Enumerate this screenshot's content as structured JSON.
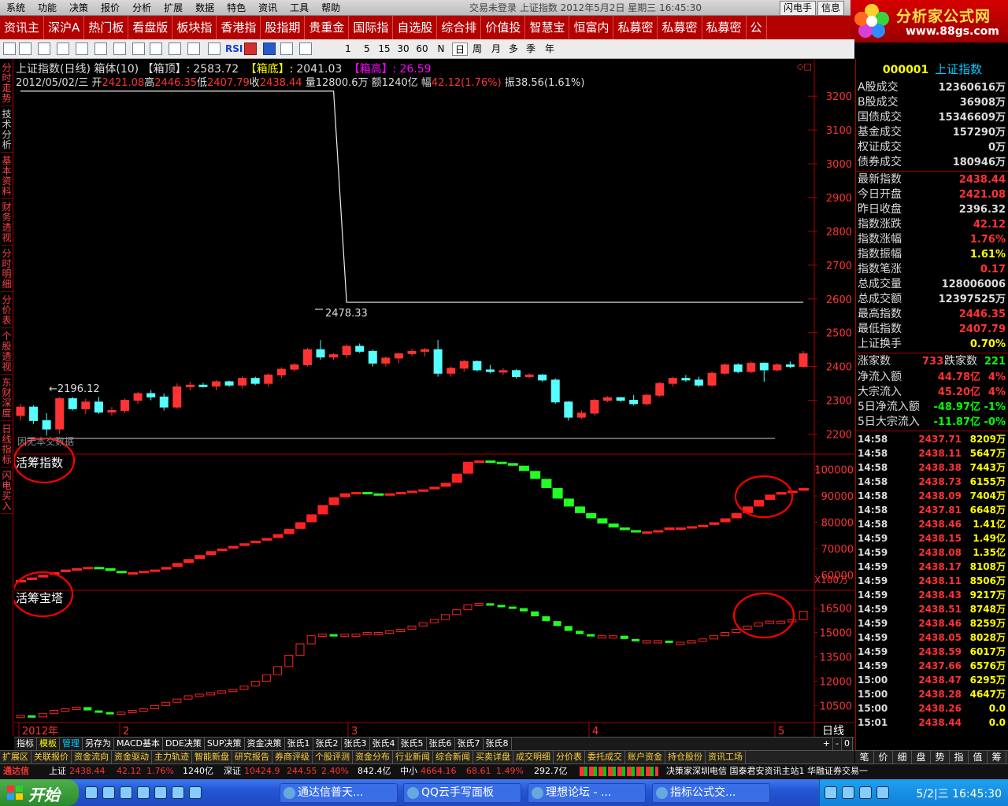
{
  "titlebar": {
    "menus": [
      "系统",
      "功能",
      "决策",
      "报价",
      "分析",
      "扩展",
      "数据",
      "特色",
      "资讯",
      "工具",
      "帮助"
    ],
    "status": "交易未登录  上证指数  2012年5月2日 星期三  16:45:30",
    "buttons": [
      "闪电手",
      "信息"
    ]
  },
  "logo": {
    "name": "分析家公式网",
    "url": "www.88gs.com"
  },
  "nav": [
    "资讯主",
    "深沪A",
    "热门板",
    "看盘版",
    "板块指",
    "香港指",
    "股指期",
    "贵重金",
    "国际指",
    "自选股",
    "综合排",
    "价值投",
    "智慧宝",
    "恒富内",
    "私募密",
    "私募密",
    "私募密",
    "公"
  ],
  "toolbar": {
    "periods": [
      "1",
      "5",
      "15",
      "30",
      "60",
      "N",
      "日",
      "周",
      "月",
      "多",
      "季",
      "年"
    ],
    "rsi": "RSI"
  },
  "left_tabs": [
    "分时走势",
    "技术分析",
    "基本资料",
    "财务透视",
    "分时明细",
    "分价表",
    "个股透视",
    "东财深度",
    "日线指标",
    "闪电买入"
  ],
  "chart": {
    "header1": {
      "name": "上证指数(日线) 箱体(10)",
      "box_top_label": "【箱顶】",
      "box_top_sep": ":",
      "box_top": "2583.72",
      "box_bottom_label": "【箱底】",
      "box_bottom_sep": ":",
      "box_bottom": "2041.03",
      "box_height_label": "【箱高】",
      "box_height_sep": ":",
      "box_height": "26.59"
    },
    "header2": {
      "date": "2012/05/02/三",
      "open_label": "开",
      "open": "2421.08",
      "high_label": "高",
      "high": "2446.35",
      "low_label": "低",
      "low": "2407.79",
      "close_label": "收",
      "close": "2438.44",
      "vol_label": "量",
      "vol": "12800.6万",
      "amt_label": "额",
      "amt": "1240亿",
      "chg_label": "幅",
      "chg": "42.12(1.76%)",
      "amp_label": "振",
      "amp": "38.56(1.61%)"
    },
    "annot_high": "2478.33",
    "annot_low": "←2196.12",
    "missing_data": "因无本交数据",
    "sub1_label": "活筹指数",
    "sub2_label": "活筹宝塔",
    "unit": "X100万",
    "x_labels": [
      "2012年",
      "2",
      "3",
      "4",
      "5"
    ],
    "period_label": "日线",
    "price_axis": [
      "3200",
      "3100",
      "3000",
      "2900",
      "2800",
      "2700",
      "2600",
      "2500",
      "2400",
      "2300",
      "2200"
    ],
    "sub1_axis": [
      "100000",
      "90000",
      "80000",
      "70000",
      "60000"
    ],
    "sub2_axis": [
      "16500",
      "15000",
      "13500",
      "12000",
      "10500"
    ]
  },
  "chart_data": [
    {
      "type": "candlestick",
      "title": "上证指数(日线) 箱体(10)",
      "ylim": [
        2150,
        3240
      ],
      "ohlc": [
        [
          2255,
          2290,
          2240,
          2280
        ],
        [
          2280,
          2285,
          2230,
          2240
        ],
        [
          2240,
          2262,
          2196,
          2215
        ],
        [
          2215,
          2310,
          2200,
          2305
        ],
        [
          2305,
          2310,
          2270,
          2275
        ],
        [
          2275,
          2305,
          2260,
          2295
        ],
        [
          2295,
          2310,
          2260,
          2265
        ],
        [
          2265,
          2280,
          2255,
          2270
        ],
        [
          2270,
          2305,
          2262,
          2300
        ],
        [
          2300,
          2325,
          2290,
          2320
        ],
        [
          2320,
          2330,
          2300,
          2310
        ],
        [
          2310,
          2320,
          2270,
          2280
        ],
        [
          2280,
          2350,
          2275,
          2340
        ],
        [
          2340,
          2355,
          2330,
          2345
        ],
        [
          2345,
          2352,
          2338,
          2342
        ],
        [
          2342,
          2360,
          2330,
          2355
        ],
        [
          2355,
          2358,
          2340,
          2345
        ],
        [
          2345,
          2372,
          2335,
          2365
        ],
        [
          2365,
          2370,
          2345,
          2350
        ],
        [
          2350,
          2380,
          2340,
          2375
        ],
        [
          2375,
          2398,
          2365,
          2392
        ],
        [
          2392,
          2410,
          2385,
          2405
        ],
        [
          2405,
          2455,
          2400,
          2450
        ],
        [
          2450,
          2478,
          2420,
          2428
        ],
        [
          2428,
          2440,
          2420,
          2435
        ],
        [
          2435,
          2465,
          2425,
          2460
        ],
        [
          2460,
          2468,
          2440,
          2445
        ],
        [
          2445,
          2450,
          2400,
          2410
        ],
        [
          2410,
          2430,
          2400,
          2425
        ],
        [
          2425,
          2440,
          2410,
          2438
        ],
        [
          2438,
          2452,
          2430,
          2445
        ],
        [
          2445,
          2455,
          2430,
          2450
        ],
        [
          2450,
          2478,
          2370,
          2380
        ],
        [
          2380,
          2400,
          2370,
          2395
        ],
        [
          2395,
          2420,
          2385,
          2415
        ],
        [
          2415,
          2418,
          2385,
          2390
        ],
        [
          2390,
          2405,
          2380,
          2385
        ],
        [
          2385,
          2395,
          2375,
          2388
        ],
        [
          2388,
          2392,
          2365,
          2370
        ],
        [
          2370,
          2380,
          2365,
          2375
        ],
        [
          2375,
          2378,
          2355,
          2360
        ],
        [
          2360,
          2365,
          2290,
          2295
        ],
        [
          2295,
          2298,
          2240,
          2250
        ],
        [
          2250,
          2270,
          2245,
          2262
        ],
        [
          2262,
          2305,
          2255,
          2300
        ],
        [
          2300,
          2312,
          2295,
          2308
        ],
        [
          2308,
          2310,
          2295,
          2300
        ],
        [
          2300,
          2315,
          2285,
          2290
        ],
        [
          2290,
          2320,
          2285,
          2315
        ],
        [
          2315,
          2355,
          2310,
          2350
        ],
        [
          2350,
          2370,
          2340,
          2365
        ],
        [
          2365,
          2375,
          2355,
          2360
        ],
        [
          2360,
          2370,
          2340,
          2345
        ],
        [
          2345,
          2385,
          2340,
          2380
        ],
        [
          2380,
          2410,
          2375,
          2405
        ],
        [
          2405,
          2410,
          2380,
          2385
        ],
        [
          2385,
          2415,
          2380,
          2410
        ],
        [
          2410,
          2412,
          2355,
          2390
        ],
        [
          2390,
          2410,
          2385,
          2405
        ],
        [
          2405,
          2415,
          2395,
          2400
        ],
        [
          2400,
          2446,
          2396,
          2438
        ]
      ],
      "box_line": [
        [
          0,
          3215
        ],
        [
          24,
          3215
        ],
        [
          25,
          2590
        ],
        [
          60,
          2590
        ]
      ]
    },
    {
      "type": "column",
      "title": "活筹指数",
      "ylim": [
        55000,
        105000
      ],
      "values": [
        58000,
        59000,
        60000,
        61000,
        62000,
        62500,
        63000,
        62500,
        61500,
        61000,
        61000,
        61500,
        62000,
        63000,
        64500,
        66000,
        67500,
        69000,
        70000,
        71000,
        72000,
        73000,
        74000,
        75500,
        77500,
        80000,
        83000,
        86500,
        89500,
        91000,
        91500,
        91000,
        90500,
        91000,
        91500,
        92000,
        92500,
        93500,
        95000,
        98500,
        103000,
        103500,
        103000,
        102500,
        101500,
        99500,
        96500,
        93000,
        89000,
        86000,
        83500,
        81500,
        79500,
        78000,
        77000,
        76500,
        76500,
        77000,
        78000,
        78000,
        78500,
        79000,
        80000,
        81500,
        83500,
        86000,
        88500,
        90500,
        91500,
        92000,
        93000
      ]
    },
    {
      "type": "column",
      "title": "活筹宝塔",
      "ylim": [
        9500,
        17500
      ],
      "values": [
        9900,
        9800,
        10000,
        10200,
        10300,
        10400,
        10200,
        10100,
        10000,
        10100,
        10200,
        10300,
        10500,
        10700,
        10900,
        11100,
        11200,
        11300,
        11400,
        11500,
        11700,
        12000,
        12400,
        12900,
        13600,
        14300,
        14800,
        14900,
        14800,
        14900,
        14900,
        15000,
        15000,
        15100,
        15200,
        15400,
        15600,
        15800,
        16100,
        16400,
        16700,
        16800,
        16700,
        16600,
        16500,
        16300,
        16000,
        15700,
        15400,
        15100,
        14900,
        14800,
        14800,
        14800,
        14600,
        14500,
        14500,
        14500,
        14400,
        14400,
        14500,
        14600,
        14800,
        15000,
        15200,
        15400,
        15600,
        15700,
        15700,
        15800,
        16300
      ]
    }
  ],
  "right_panel": {
    "code": "000001",
    "name": "上证指数",
    "stats1": [
      [
        "A股成交",
        "12360616万"
      ],
      [
        "B股成交",
        "36908万"
      ],
      [
        "国债成交",
        "15346609万"
      ],
      [
        "基金成交",
        "157290万"
      ],
      [
        "权证成交",
        "0万"
      ],
      [
        "债券成交",
        "180946万"
      ]
    ],
    "stats2": [
      [
        "最新指数",
        "2438.44",
        "#f33"
      ],
      [
        "今日开盘",
        "2421.08",
        "#f33"
      ],
      [
        "昨日收盘",
        "2396.32",
        "#ddd"
      ],
      [
        "指数涨跌",
        "42.12",
        "#f33"
      ],
      [
        "指数涨幅",
        "1.76%",
        "#f33"
      ],
      [
        "指数振幅",
        "1.61%",
        "#ff0"
      ],
      [
        "指数笔涨",
        "0.17",
        "#f33"
      ],
      [
        "总成交量",
        "128006006",
        "#ddd"
      ],
      [
        "总成交额",
        "12397525万",
        "#ddd"
      ],
      [
        "最高指数",
        "2446.35",
        "#f33"
      ],
      [
        "最低指数",
        "2407.79",
        "#f33"
      ],
      [
        "上证换手",
        "0.70%",
        "#ff0"
      ]
    ],
    "updown": {
      "up_label": "涨家数",
      "up": "733",
      "down_label": "跌家数",
      "down": "221"
    },
    "flows": [
      [
        "净流入额",
        "44.78亿",
        "4%",
        "#f33"
      ],
      [
        "大宗流入",
        "45.20亿",
        "4%",
        "#f33"
      ],
      [
        "5日净流入额",
        "-48.97亿",
        "-1%",
        "#0f0"
      ],
      [
        "5日大宗流入",
        "-11.87亿",
        "-0%",
        "#0f0"
      ]
    ],
    "ticks": [
      [
        "14:58",
        "2437.71",
        "8209万"
      ],
      [
        "14:58",
        "2438.11",
        "5647万"
      ],
      [
        "14:58",
        "2438.38",
        "7443万"
      ],
      [
        "14:58",
        "2438.73",
        "6155万"
      ],
      [
        "14:58",
        "2438.09",
        "7404万"
      ],
      [
        "14:58",
        "2437.81",
        "6648万"
      ],
      [
        "14:58",
        "2438.46",
        "1.41亿"
      ],
      [
        "14:59",
        "2438.15",
        "1.49亿"
      ],
      [
        "14:59",
        "2438.08",
        "1.35亿"
      ],
      [
        "14:59",
        "2438.17",
        "8108万"
      ],
      [
        "14:59",
        "2438.11",
        "8506万"
      ],
      [
        "14:59",
        "2438.43",
        "9217万"
      ],
      [
        "14:59",
        "2438.51",
        "8748万"
      ],
      [
        "14:59",
        "2438.46",
        "8259万"
      ],
      [
        "14:59",
        "2438.05",
        "8028万"
      ],
      [
        "14:59",
        "2438.59",
        "6017万"
      ],
      [
        "14:59",
        "2437.66",
        "6576万"
      ],
      [
        "15:00",
        "2438.47",
        "6295万"
      ],
      [
        "15:00",
        "2438.28",
        "4647万"
      ],
      [
        "15:00",
        "2438.26",
        "0.0"
      ],
      [
        "15:01",
        "2438.44",
        "0.0"
      ]
    ]
  },
  "tabs1": [
    "指标",
    "模板",
    "管理",
    "另存为",
    "MACD基本",
    "DDE决策",
    "SUP决策",
    "资金决策",
    "张氏1",
    "张氏2",
    "张氏3",
    "张氏4",
    "张氏5",
    "张氏6",
    "张氏7",
    "张氏8"
  ],
  "tabs1_right": [
    "+",
    "-",
    "0"
  ],
  "tabs2": [
    "扩展区",
    "关联报价",
    "资金流向",
    "资金驱动",
    "主力轨迹",
    "智能新盘",
    "研究报告",
    "券商评级",
    "个股评测",
    "资金分布",
    "行业新闻",
    "综合新闻",
    "买卖详盘",
    "成交明细",
    "分价表",
    "委托成交",
    "账户资金",
    "持仓股份",
    "资讯工场"
  ],
  "rtabs": [
    "笔",
    "价",
    "细",
    "盘",
    "势",
    "指",
    "值",
    "筹"
  ],
  "status": {
    "app": "通达信",
    "sh_label": "上证",
    "sh": "2438.44",
    "sh_chg": "42.12",
    "sh_pct": "1.76%",
    "sh_amt": "1240亿",
    "sz_label": "深证",
    "sz": "10424.9",
    "sz_chg": "244.55",
    "sz_pct": "2.40%",
    "sz_amt": "842.4亿",
    "zx_label": "中小",
    "zx": "4664.16",
    "zx_chg": "68.61",
    "zx_pct": "1.49%",
    "zx_amt": "292.7亿",
    "info": "决策家深圳电信  国泰君安资讯主站1  华融证券交易一"
  },
  "taskbar": {
    "start": "开始",
    "tasks": [
      "通达信普天...",
      "QQ云手写面板",
      "理想论坛 - ...",
      "指标公式交..."
    ],
    "clock": "5/2|三 16:45:30"
  }
}
